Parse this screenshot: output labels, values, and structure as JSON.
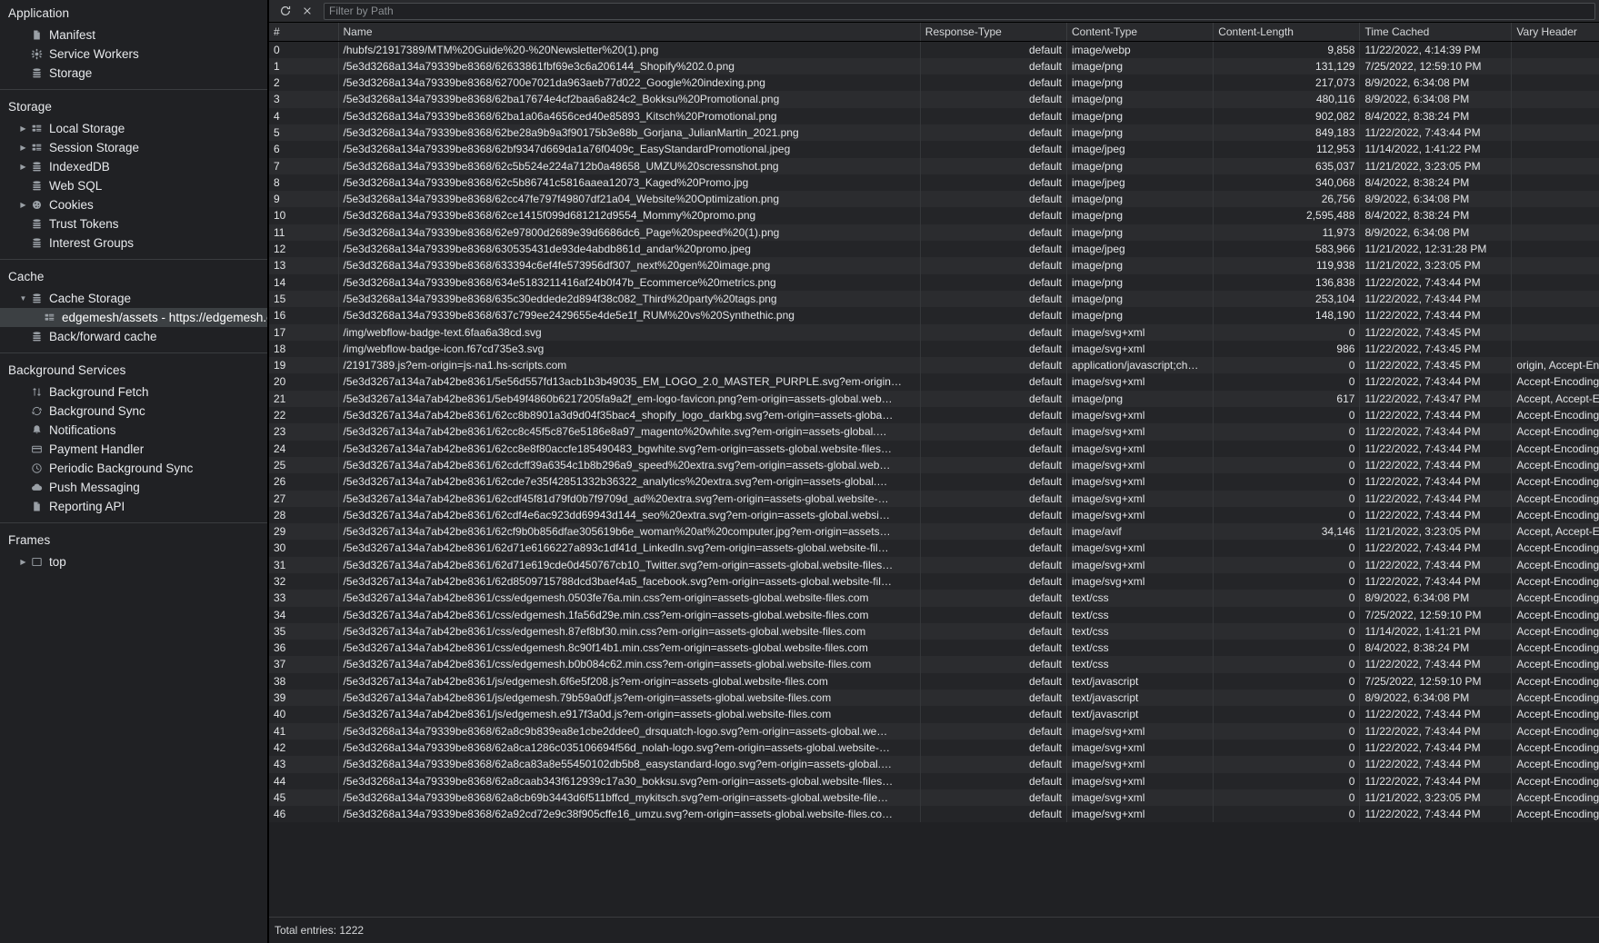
{
  "sidebar": {
    "sections": [
      {
        "title": "Application",
        "items": [
          {
            "label": "Manifest",
            "icon": "document-icon",
            "level": 1,
            "twisty": "none",
            "selected": false
          },
          {
            "label": "Service Workers",
            "icon": "gear-icon",
            "level": 1,
            "twisty": "none",
            "selected": false
          },
          {
            "label": "Storage",
            "icon": "database-icon",
            "level": 1,
            "twisty": "none",
            "selected": false
          }
        ]
      },
      {
        "title": "Storage",
        "items": [
          {
            "label": "Local Storage",
            "icon": "table-icon",
            "level": 1,
            "twisty": "collapsed",
            "selected": false
          },
          {
            "label": "Session Storage",
            "icon": "table-icon",
            "level": 1,
            "twisty": "collapsed",
            "selected": false
          },
          {
            "label": "IndexedDB",
            "icon": "database-icon",
            "level": 1,
            "twisty": "collapsed",
            "selected": false
          },
          {
            "label": "Web SQL",
            "icon": "database-icon",
            "level": 1,
            "twisty": "none",
            "selected": false
          },
          {
            "label": "Cookies",
            "icon": "cookie-icon",
            "level": 1,
            "twisty": "collapsed",
            "selected": false
          },
          {
            "label": "Trust Tokens",
            "icon": "database-icon",
            "level": 1,
            "twisty": "none",
            "selected": false
          },
          {
            "label": "Interest Groups",
            "icon": "database-icon",
            "level": 1,
            "twisty": "none",
            "selected": false
          }
        ]
      },
      {
        "title": "Cache",
        "items": [
          {
            "label": "Cache Storage",
            "icon": "database-icon",
            "level": 1,
            "twisty": "expanded",
            "selected": false
          },
          {
            "label": "edgemesh/assets - https://edgemesh.com",
            "icon": "table-icon",
            "level": 2,
            "twisty": "none",
            "selected": true
          },
          {
            "label": "Back/forward cache",
            "icon": "database-icon",
            "level": 1,
            "twisty": "none",
            "selected": false
          }
        ]
      },
      {
        "title": "Background Services",
        "items": [
          {
            "label": "Background Fetch",
            "icon": "arrows-updown-icon",
            "level": 1,
            "twisty": "none",
            "selected": false
          },
          {
            "label": "Background Sync",
            "icon": "sync-icon",
            "level": 1,
            "twisty": "none",
            "selected": false
          },
          {
            "label": "Notifications",
            "icon": "bell-icon",
            "level": 1,
            "twisty": "none",
            "selected": false
          },
          {
            "label": "Payment Handler",
            "icon": "card-icon",
            "level": 1,
            "twisty": "none",
            "selected": false
          },
          {
            "label": "Periodic Background Sync",
            "icon": "clock-icon",
            "level": 1,
            "twisty": "none",
            "selected": false
          },
          {
            "label": "Push Messaging",
            "icon": "cloud-icon",
            "level": 1,
            "twisty": "none",
            "selected": false
          },
          {
            "label": "Reporting API",
            "icon": "document-icon",
            "level": 1,
            "twisty": "none",
            "selected": false
          }
        ]
      },
      {
        "title": "Frames",
        "items": [
          {
            "label": "top",
            "icon": "frame-icon",
            "level": 1,
            "twisty": "collapsed",
            "selected": false
          }
        ]
      }
    ]
  },
  "toolbar": {
    "refresh_label": "refresh-icon",
    "clear_label": "clear-icon",
    "filter_placeholder": "Filter by Path",
    "filter_value": ""
  },
  "table": {
    "columns": [
      "#",
      "Name",
      "Response-Type",
      "Content-Type",
      "Content-Length",
      "Time Cached",
      "Vary Header"
    ],
    "rows": [
      [
        "0",
        "/hubfs/21917389/MTM%20Guide%20-%20Newsletter%20(1).png",
        "default",
        "image/webp",
        "9,858",
        "11/22/2022, 4:14:39 PM",
        ""
      ],
      [
        "1",
        "/5e3d3268a134a79339be8368/62633861fbf69e3c6a206144_Shopify%202.0.png",
        "default",
        "image/png",
        "131,129",
        "7/25/2022, 12:59:10 PM",
        ""
      ],
      [
        "2",
        "/5e3d3268a134a79339be8368/62700e7021da963aeb77d022_Google%20indexing.png",
        "default",
        "image/png",
        "217,073",
        "8/9/2022, 6:34:08 PM",
        ""
      ],
      [
        "3",
        "/5e3d3268a134a79339be8368/62ba17674e4cf2baa6a824c2_Bokksu%20Promotional.png",
        "default",
        "image/png",
        "480,116",
        "8/9/2022, 6:34:08 PM",
        ""
      ],
      [
        "4",
        "/5e3d3268a134a79339be8368/62ba1a06a4656ced40e85893_Kitsch%20Promotional.png",
        "default",
        "image/png",
        "902,082",
        "8/4/2022, 8:38:24 PM",
        ""
      ],
      [
        "5",
        "/5e3d3268a134a79339be8368/62be28a9b9a3f90175b3e88b_Gorjana_JulianMartin_2021.png",
        "default",
        "image/png",
        "849,183",
        "11/22/2022, 7:43:44 PM",
        ""
      ],
      [
        "6",
        "/5e3d3268a134a79339be8368/62bf9347d669da1a76f0409c_EasyStandardPromotional.jpeg",
        "default",
        "image/jpeg",
        "112,953",
        "11/14/2022, 1:41:22 PM",
        ""
      ],
      [
        "7",
        "/5e3d3268a134a79339be8368/62c5b524e224a712b0a48658_UMZU%20scressnshot.png",
        "default",
        "image/png",
        "635,037",
        "11/21/2022, 3:23:05 PM",
        ""
      ],
      [
        "8",
        "/5e3d3268a134a79339be8368/62c5b86741c5816aaea12073_Kaged%20Promo.jpg",
        "default",
        "image/jpeg",
        "340,068",
        "8/4/2022, 8:38:24 PM",
        ""
      ],
      [
        "9",
        "/5e3d3268a134a79339be8368/62cc47fe797f49807df21a04_Website%20Optimization.png",
        "default",
        "image/png",
        "26,756",
        "8/9/2022, 6:34:08 PM",
        ""
      ],
      [
        "10",
        "/5e3d3268a134a79339be8368/62ce1415f099d681212d9554_Mommy%20promo.png",
        "default",
        "image/png",
        "2,595,488",
        "8/4/2022, 8:38:24 PM",
        ""
      ],
      [
        "11",
        "/5e3d3268a134a79339be8368/62e97800d2689e39d6686dc6_Page%20speed%20(1).png",
        "default",
        "image/png",
        "11,973",
        "8/9/2022, 6:34:08 PM",
        ""
      ],
      [
        "12",
        "/5e3d3268a134a79339be8368/630535431de93de4abdb861d_andar%20promo.jpeg",
        "default",
        "image/jpeg",
        "583,966",
        "11/21/2022, 12:31:28 PM",
        ""
      ],
      [
        "13",
        "/5e3d3268a134a79339be8368/633394c6ef4fe573956df307_next%20gen%20image.png",
        "default",
        "image/png",
        "119,938",
        "11/21/2022, 3:23:05 PM",
        ""
      ],
      [
        "14",
        "/5e3d3268a134a79339be8368/634e5183211416af24b0f47b_Ecommerce%20metrics.png",
        "default",
        "image/png",
        "136,838",
        "11/22/2022, 7:43:44 PM",
        ""
      ],
      [
        "15",
        "/5e3d3268a134a79339be8368/635c30eddede2d894f38c082_Third%20party%20tags.png",
        "default",
        "image/png",
        "253,104",
        "11/22/2022, 7:43:44 PM",
        ""
      ],
      [
        "16",
        "/5e3d3268a134a79339be8368/637c799ee2429655e4de5e1f_RUM%20vs%20Synthethic.png",
        "default",
        "image/png",
        "148,190",
        "11/22/2022, 7:43:44 PM",
        ""
      ],
      [
        "17",
        "/img/webflow-badge-text.6faa6a38cd.svg",
        "default",
        "image/svg+xml",
        "0",
        "11/22/2022, 7:43:45 PM",
        ""
      ],
      [
        "18",
        "/img/webflow-badge-icon.f67cd735e3.svg",
        "default",
        "image/svg+xml",
        "986",
        "11/22/2022, 7:43:45 PM",
        ""
      ],
      [
        "19",
        "/21917389.js?em-origin=js-na1.hs-scripts.com",
        "default",
        "application/javascript;ch…",
        "0",
        "11/22/2022, 7:43:45 PM",
        "origin, Accept-Encoding"
      ],
      [
        "20",
        "/5e3d3267a134a7ab42be8361/5e56d557fd13acb1b3b49035_EM_LOGO_2.0_MASTER_PURPLE.svg?em-origin…",
        "default",
        "image/svg+xml",
        "0",
        "11/22/2022, 7:43:44 PM",
        "Accept-Encoding"
      ],
      [
        "21",
        "/5e3d3267a134a7ab42be8361/5eb49f4860b6217205fa9a2f_em-logo-favicon.png?em-origin=assets-global.web…",
        "default",
        "image/png",
        "617",
        "11/22/2022, 7:43:47 PM",
        "Accept, Accept-Encoding"
      ],
      [
        "22",
        "/5e3d3267a134a7ab42be8361/62cc8b8901a3d9d04f35bac4_shopify_logo_darkbg.svg?em-origin=assets-globa…",
        "default",
        "image/svg+xml",
        "0",
        "11/22/2022, 7:43:44 PM",
        "Accept-Encoding"
      ],
      [
        "23",
        "/5e3d3267a134a7ab42be8361/62cc8c45f5c876e5186e8a97_magento%20white.svg?em-origin=assets-global.…",
        "default",
        "image/svg+xml",
        "0",
        "11/22/2022, 7:43:44 PM",
        "Accept-Encoding"
      ],
      [
        "24",
        "/5e3d3267a134a7ab42be8361/62cc8e8f80accfe185490483_bgwhite.svg?em-origin=assets-global.website-files…",
        "default",
        "image/svg+xml",
        "0",
        "11/22/2022, 7:43:44 PM",
        "Accept-Encoding"
      ],
      [
        "25",
        "/5e3d3267a134a7ab42be8361/62cdcff39a6354c1b8b296a9_speed%20extra.svg?em-origin=assets-global.web…",
        "default",
        "image/svg+xml",
        "0",
        "11/22/2022, 7:43:44 PM",
        "Accept-Encoding"
      ],
      [
        "26",
        "/5e3d3267a134a7ab42be8361/62cde7e35f42851332b36322_analytics%20extra.svg?em-origin=assets-global.…",
        "default",
        "image/svg+xml",
        "0",
        "11/22/2022, 7:43:44 PM",
        "Accept-Encoding"
      ],
      [
        "27",
        "/5e3d3267a134a7ab42be8361/62cdf45f81d79fd0b7f9709d_ad%20extra.svg?em-origin=assets-global.website-…",
        "default",
        "image/svg+xml",
        "0",
        "11/22/2022, 7:43:44 PM",
        "Accept-Encoding"
      ],
      [
        "28",
        "/5e3d3267a134a7ab42be8361/62cdf4e6ac923dd69943d144_seo%20extra.svg?em-origin=assets-global.websi…",
        "default",
        "image/svg+xml",
        "0",
        "11/22/2022, 7:43:44 PM",
        "Accept-Encoding"
      ],
      [
        "29",
        "/5e3d3267a134a7ab42be8361/62cf9b0b856dfae305619b6e_woman%20at%20computer.jpg?em-origin=assets…",
        "default",
        "image/avif",
        "34,146",
        "11/21/2022, 3:23:05 PM",
        "Accept, Accept-Encoding"
      ],
      [
        "30",
        "/5e3d3267a134a7ab42be8361/62d71e6166227a893c1df41d_LinkedIn.svg?em-origin=assets-global.website-fil…",
        "default",
        "image/svg+xml",
        "0",
        "11/22/2022, 7:43:44 PM",
        "Accept-Encoding"
      ],
      [
        "31",
        "/5e3d3267a134a7ab42be8361/62d71e619cde0d450767cb10_Twitter.svg?em-origin=assets-global.website-files…",
        "default",
        "image/svg+xml",
        "0",
        "11/22/2022, 7:43:44 PM",
        "Accept-Encoding"
      ],
      [
        "32",
        "/5e3d3267a134a7ab42be8361/62d8509715788dcd3baef4a5_facebook.svg?em-origin=assets-global.website-fil…",
        "default",
        "image/svg+xml",
        "0",
        "11/22/2022, 7:43:44 PM",
        "Accept-Encoding"
      ],
      [
        "33",
        "/5e3d3267a134a7ab42be8361/css/edgemesh.0503fe76a.min.css?em-origin=assets-global.website-files.com",
        "default",
        "text/css",
        "0",
        "8/9/2022, 6:34:08 PM",
        "Accept-Encoding"
      ],
      [
        "34",
        "/5e3d3267a134a7ab42be8361/css/edgemesh.1fa56d29e.min.css?em-origin=assets-global.website-files.com",
        "default",
        "text/css",
        "0",
        "7/25/2022, 12:59:10 PM",
        "Accept-Encoding"
      ],
      [
        "35",
        "/5e3d3267a134a7ab42be8361/css/edgemesh.87ef8bf30.min.css?em-origin=assets-global.website-files.com",
        "default",
        "text/css",
        "0",
        "11/14/2022, 1:41:21 PM",
        "Accept-Encoding"
      ],
      [
        "36",
        "/5e3d3267a134a7ab42be8361/css/edgemesh.8c90f14b1.min.css?em-origin=assets-global.website-files.com",
        "default",
        "text/css",
        "0",
        "8/4/2022, 8:38:24 PM",
        "Accept-Encoding"
      ],
      [
        "37",
        "/5e3d3267a134a7ab42be8361/css/edgemesh.b0b084c62.min.css?em-origin=assets-global.website-files.com",
        "default",
        "text/css",
        "0",
        "11/22/2022, 7:43:44 PM",
        "Accept-Encoding"
      ],
      [
        "38",
        "/5e3d3267a134a7ab42be8361/js/edgemesh.6f6e5f208.js?em-origin=assets-global.website-files.com",
        "default",
        "text/javascript",
        "0",
        "7/25/2022, 12:59:10 PM",
        "Accept-Encoding"
      ],
      [
        "39",
        "/5e3d3267a134a7ab42be8361/js/edgemesh.79b59a0df.js?em-origin=assets-global.website-files.com",
        "default",
        "text/javascript",
        "0",
        "8/9/2022, 6:34:08 PM",
        "Accept-Encoding"
      ],
      [
        "40",
        "/5e3d3267a134a7ab42be8361/js/edgemesh.e917f3a0d.js?em-origin=assets-global.website-files.com",
        "default",
        "text/javascript",
        "0",
        "11/22/2022, 7:43:44 PM",
        "Accept-Encoding"
      ],
      [
        "41",
        "/5e3d3268a134a79339be8368/62a8c9b839ea8e1cbe2ddee0_drsquatch-logo.svg?em-origin=assets-global.we…",
        "default",
        "image/svg+xml",
        "0",
        "11/22/2022, 7:43:44 PM",
        "Accept-Encoding"
      ],
      [
        "42",
        "/5e3d3268a134a79339be8368/62a8ca1286c035106694f56d_nolah-logo.svg?em-origin=assets-global.website-…",
        "default",
        "image/svg+xml",
        "0",
        "11/22/2022, 7:43:44 PM",
        "Accept-Encoding"
      ],
      [
        "43",
        "/5e3d3268a134a79339be8368/62a8ca83a8e55450102db5b8_easystandard-logo.svg?em-origin=assets-global.…",
        "default",
        "image/svg+xml",
        "0",
        "11/22/2022, 7:43:44 PM",
        "Accept-Encoding"
      ],
      [
        "44",
        "/5e3d3268a134a79339be8368/62a8caab343f612939c17a30_bokksu.svg?em-origin=assets-global.website-files…",
        "default",
        "image/svg+xml",
        "0",
        "11/22/2022, 7:43:44 PM",
        "Accept-Encoding"
      ],
      [
        "45",
        "/5e3d3268a134a79339be8368/62a8cb69b3443d6f511bffcd_mykitsch.svg?em-origin=assets-global.website-file…",
        "default",
        "image/svg+xml",
        "0",
        "11/21/2022, 3:23:05 PM",
        "Accept-Encoding"
      ],
      [
        "46",
        "/5e3d3268a134a79339be8368/62a92cd72e9c38f905cffe16_umzu.svg?em-origin=assets-global.website-files.co…",
        "default",
        "image/svg+xml",
        "0",
        "11/22/2022, 7:43:44 PM",
        "Accept-Encoding"
      ]
    ]
  },
  "footer": {
    "total_entries": "Total entries: 1222"
  },
  "colors": {
    "background": "#202124",
    "toolbar": "#292a2d",
    "selected_row": "#3c4043",
    "text": "#e8eaed",
    "muted": "#9aa0a6"
  }
}
